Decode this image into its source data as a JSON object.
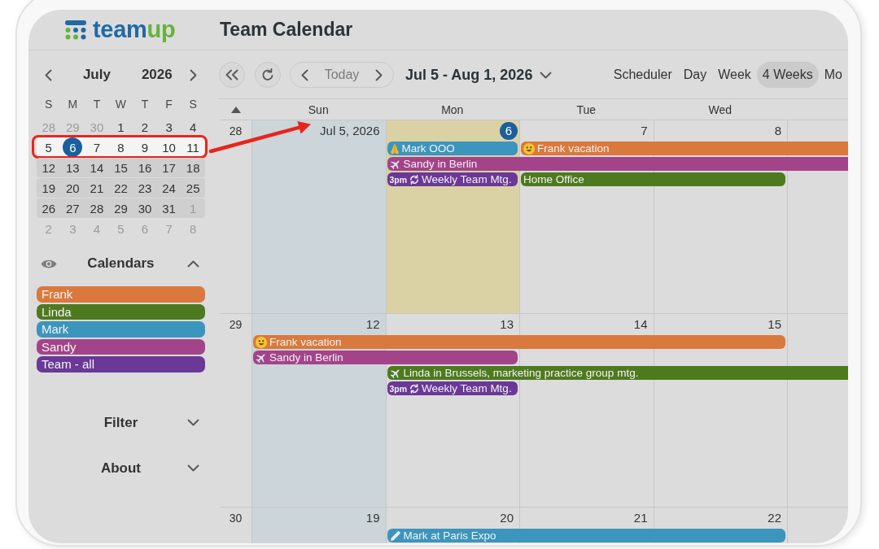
{
  "header": {
    "logo": {
      "text": "team",
      "accent": "up"
    },
    "title": "Team Calendar"
  },
  "sidebar": {
    "mini_calendar": {
      "month": "July",
      "year": "2026",
      "weekdays": [
        "S",
        "M",
        "T",
        "W",
        "T",
        "F",
        "S"
      ],
      "weeks": [
        {
          "in_range": false,
          "highlighted": false,
          "days": [
            {
              "label": "28",
              "outside": true,
              "today": false
            },
            {
              "label": "29",
              "outside": true,
              "today": false
            },
            {
              "label": "30",
              "outside": true,
              "today": false
            },
            {
              "label": "1",
              "outside": false,
              "today": false
            },
            {
              "label": "2",
              "outside": false,
              "today": false
            },
            {
              "label": "3",
              "outside": false,
              "today": false
            },
            {
              "label": "4",
              "outside": false,
              "today": false
            }
          ]
        },
        {
          "in_range": true,
          "highlighted": true,
          "days": [
            {
              "label": "5",
              "outside": false,
              "today": false
            },
            {
              "label": "6",
              "outside": false,
              "today": true
            },
            {
              "label": "7",
              "outside": false,
              "today": false
            },
            {
              "label": "8",
              "outside": false,
              "today": false
            },
            {
              "label": "9",
              "outside": false,
              "today": false
            },
            {
              "label": "10",
              "outside": false,
              "today": false
            },
            {
              "label": "11",
              "outside": false,
              "today": false
            }
          ]
        },
        {
          "in_range": true,
          "highlighted": false,
          "days": [
            {
              "label": "12",
              "outside": false,
              "today": false
            },
            {
              "label": "13",
              "outside": false,
              "today": false
            },
            {
              "label": "14",
              "outside": false,
              "today": false
            },
            {
              "label": "15",
              "outside": false,
              "today": false
            },
            {
              "label": "16",
              "outside": false,
              "today": false
            },
            {
              "label": "17",
              "outside": false,
              "today": false
            },
            {
              "label": "18",
              "outside": false,
              "today": false
            }
          ]
        },
        {
          "in_range": true,
          "highlighted": false,
          "days": [
            {
              "label": "19",
              "outside": false,
              "today": false
            },
            {
              "label": "20",
              "outside": false,
              "today": false
            },
            {
              "label": "21",
              "outside": false,
              "today": false
            },
            {
              "label": "22",
              "outside": false,
              "today": false
            },
            {
              "label": "23",
              "outside": false,
              "today": false
            },
            {
              "label": "24",
              "outside": false,
              "today": false
            },
            {
              "label": "25",
              "outside": false,
              "today": false
            }
          ]
        },
        {
          "in_range": true,
          "highlighted": false,
          "days": [
            {
              "label": "26",
              "outside": false,
              "today": false
            },
            {
              "label": "27",
              "outside": false,
              "today": false
            },
            {
              "label": "28",
              "outside": false,
              "today": false
            },
            {
              "label": "29",
              "outside": false,
              "today": false
            },
            {
              "label": "30",
              "outside": false,
              "today": false
            },
            {
              "label": "31",
              "outside": false,
              "today": false
            },
            {
              "label": "1",
              "outside": true,
              "today": false
            }
          ]
        },
        {
          "in_range": false,
          "highlighted": false,
          "days": [
            {
              "label": "2",
              "outside": true,
              "today": false
            },
            {
              "label": "3",
              "outside": true,
              "today": false
            },
            {
              "label": "4",
              "outside": true,
              "today": false
            },
            {
              "label": "5",
              "outside": true,
              "today": false
            },
            {
              "label": "6",
              "outside": true,
              "today": false
            },
            {
              "label": "7",
              "outside": true,
              "today": false
            },
            {
              "label": "8",
              "outside": true,
              "today": false
            }
          ]
        }
      ]
    },
    "sections": [
      {
        "kind": "calendar-list",
        "title": "Calendars",
        "expanded": true,
        "items": [
          {
            "name": "Frank",
            "color": "#d9793d"
          },
          {
            "name": "Linda",
            "color": "#4e7a1f"
          },
          {
            "name": "Mark",
            "color": "#3c95bc"
          },
          {
            "name": "Sandy",
            "color": "#a3448a"
          },
          {
            "name": "Team - all",
            "color": "#6a3896"
          }
        ]
      },
      {
        "kind": "panel",
        "title": "Filter",
        "expanded": false
      },
      {
        "kind": "panel",
        "title": "About",
        "expanded": false
      }
    ]
  },
  "toolbar": {
    "today_label": "Today",
    "range": "Jul 5 - Aug 1, 2026",
    "views": [
      {
        "label": "Scheduler",
        "selected": false
      },
      {
        "label": "Day",
        "selected": false
      },
      {
        "label": "Week",
        "selected": false
      },
      {
        "label": "4 Weeks",
        "selected": true
      },
      {
        "label": "Mo",
        "selected": false
      }
    ]
  },
  "grid": {
    "columns": [
      "Sun",
      "Mon",
      "Tue",
      "Wed"
    ],
    "weeks": [
      {
        "number": "28",
        "days": [
          {
            "label": "Jul 5, 2026",
            "weekend": true,
            "today": false
          },
          {
            "label": "6",
            "weekend": false,
            "today": true
          },
          {
            "label": "7",
            "weekend": false,
            "today": false
          },
          {
            "label": "8",
            "weekend": false,
            "today": false
          },
          {
            "weekend": false,
            "today": false
          }
        ],
        "lanes": [
          [
            {
              "kind": "gap"
            },
            {
              "kind": "ooo",
              "title": "Mark OOO",
              "color": "#3c95bc"
            },
            {
              "kind": "vacation",
              "title": "Frank vacation",
              "color": "#d9793d"
            },
            {
              "kind": "continues"
            },
            {
              "kind": "continues"
            }
          ],
          [
            {
              "kind": "gap"
            },
            {
              "kind": "trip",
              "title": "Sandy in Berlin",
              "color": "#a3448a"
            },
            {
              "kind": "continues"
            },
            {
              "kind": "continues"
            },
            {
              "kind": "continues"
            }
          ],
          [
            {
              "kind": "gap"
            },
            {
              "kind": "recurring",
              "time": "3pm",
              "title": "Weekly Team Mtg.",
              "color": "#6a3896"
            },
            {
              "kind": "plain",
              "title": "Home Office",
              "color": "#4e7a1f"
            },
            {
              "kind": "continues"
            }
          ]
        ]
      },
      {
        "number": "29",
        "days": [
          {
            "label": "12",
            "weekend": true,
            "today": false
          },
          {
            "label": "13",
            "weekend": false,
            "today": false
          },
          {
            "label": "14",
            "weekend": false,
            "today": false
          },
          {
            "label": "15",
            "weekend": false,
            "today": false
          },
          {
            "weekend": false,
            "today": false
          }
        ],
        "lanes": [
          [
            {
              "kind": "vacation",
              "title": "Frank vacation",
              "color": "#d9793d"
            },
            {
              "kind": "continues"
            },
            {
              "kind": "continues"
            },
            {
              "kind": "continues"
            }
          ],
          [
            {
              "kind": "trip",
              "title": "Sandy in Berlin",
              "color": "#a3448a"
            },
            {
              "kind": "continues"
            }
          ],
          [
            {
              "kind": "gap"
            },
            {
              "kind": "trip",
              "title": "Linda in Brussels, marketing practice group mtg.",
              "color": "#4e7a1f"
            },
            {
              "kind": "continues"
            },
            {
              "kind": "continues"
            },
            {
              "kind": "continues"
            }
          ],
          [
            {
              "kind": "gap"
            },
            {
              "kind": "recurring",
              "time": "3pm",
              "title": "Weekly Team Mtg.",
              "color": "#6a3896"
            }
          ]
        ]
      },
      {
        "number": "30",
        "days": [
          {
            "label": "19",
            "weekend": true,
            "today": false
          },
          {
            "label": "20",
            "weekend": false,
            "today": false
          },
          {
            "label": "21",
            "weekend": false,
            "today": false
          },
          {
            "label": "22",
            "weekend": false,
            "today": false
          },
          {
            "weekend": false,
            "today": false
          }
        ],
        "lanes": [
          [
            {
              "kind": "gap"
            },
            {
              "kind": "expo",
              "title": "Mark at Paris Expo",
              "color": "#3c95bc"
            },
            {
              "kind": "continues"
            },
            {
              "kind": "continues"
            }
          ]
        ]
      }
    ]
  },
  "annotation": {
    "kind": "arrow"
  }
}
